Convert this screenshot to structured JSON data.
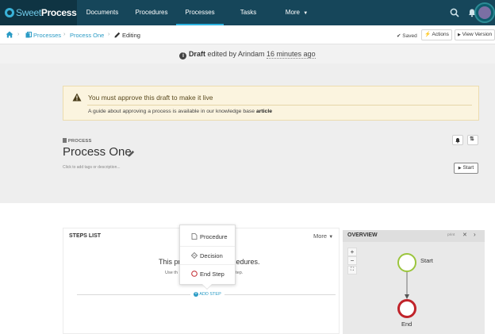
{
  "app": {
    "brand_light": "Sweet",
    "brand_bold": "Process"
  },
  "nav": {
    "items": [
      {
        "label": "Documents"
      },
      {
        "label": "Procedures"
      },
      {
        "label": "Processes",
        "active": true
      },
      {
        "label": "Tasks"
      },
      {
        "label": "More"
      }
    ]
  },
  "breadcrumb": {
    "items": [
      "Processes",
      "Process One"
    ],
    "current": "Editing"
  },
  "toolbar": {
    "saved": "Saved",
    "actions": "Actions",
    "view_version": "View Version"
  },
  "draft": {
    "label": "Draft",
    "edited_by": "edited by Arindam",
    "time": "16 minutes ago"
  },
  "alert": {
    "title": "You must approve this draft to make it live",
    "text": "A guide about approving a process is available in our knowledge base",
    "link": "article"
  },
  "process": {
    "kicker": "PROCESS",
    "title": "Process One",
    "description_placeholder": "Click to add tags or description...",
    "start": "Start"
  },
  "steps": {
    "title": "STEPS LIST",
    "more": "More",
    "empty_title_a": "This pr",
    "empty_title_b": "edures.",
    "empty_sub_a": "Use th",
    "empty_sub_b": "w step.",
    "add_step": "ADD STEP"
  },
  "add_menu": {
    "items": [
      {
        "label": "Procedure"
      },
      {
        "label": "Decision"
      },
      {
        "label": "End Step"
      }
    ]
  },
  "overview": {
    "title": "OVERVIEW",
    "print": "print",
    "zoom_in": "+",
    "zoom_out": "−",
    "fit": "⛶",
    "start_label": "Start",
    "end_label": "End"
  },
  "colors": {
    "nav_bg": "#16465a",
    "accent": "#2a9bc5",
    "start_node": "#9bc53d",
    "end_node": "#c0232a",
    "alert_bg": "#fbf4df"
  }
}
